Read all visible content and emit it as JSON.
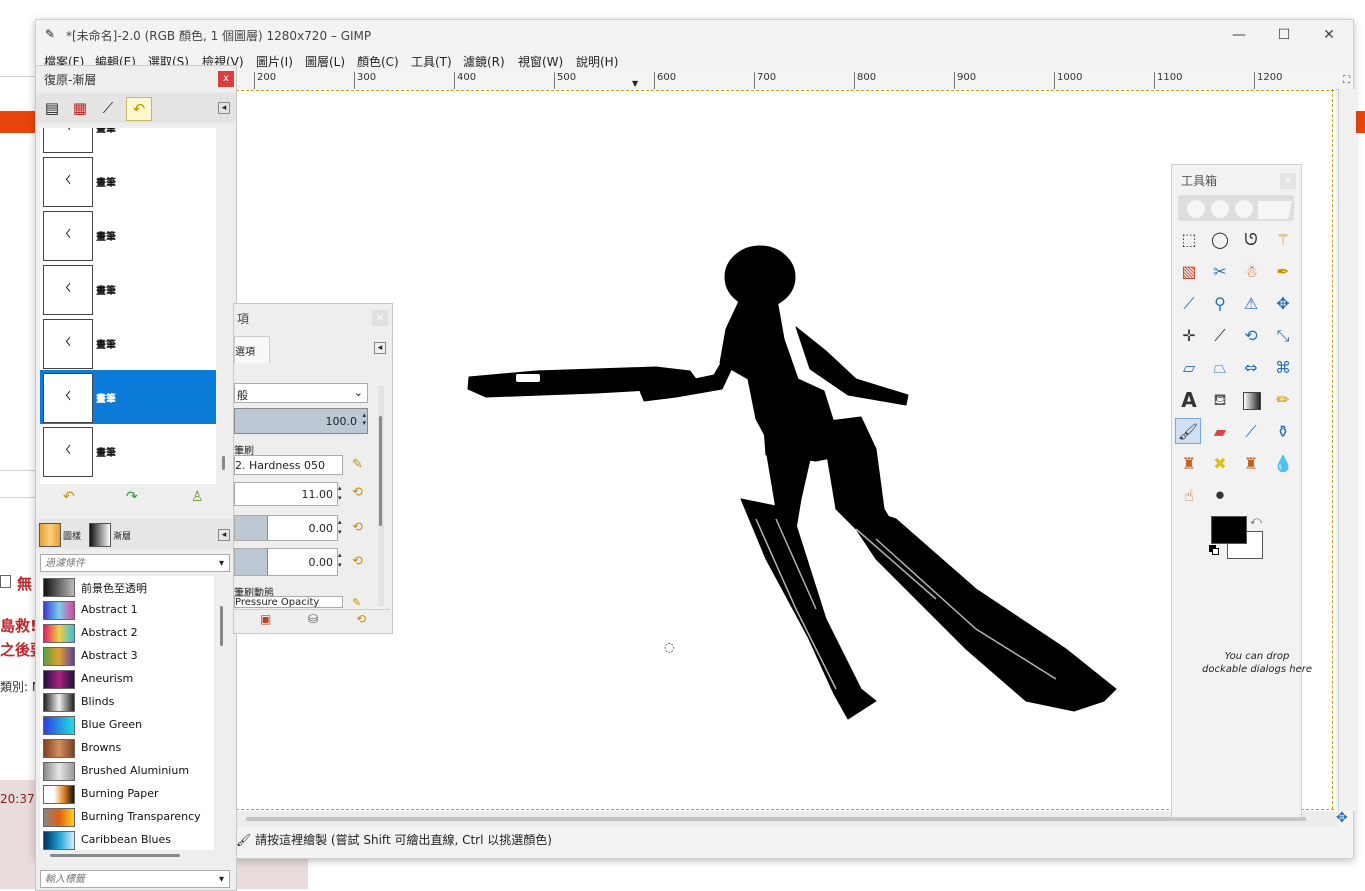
{
  "window": {
    "title": "*[未命名]-2.0 (RGB 顏色, 1 個圖層) 1280x720 – GIMP",
    "controls": [
      "—",
      "☐",
      "✕"
    ]
  },
  "menubar": {
    "items": [
      "檔案(F)",
      "編輯(E)",
      "選取(S)",
      "檢視(V)",
      "圖片(I)",
      "圖層(L)",
      "顏色(C)",
      "工具(T)",
      "濾鏡(R)",
      "視窗(W)",
      "說明(H)"
    ]
  },
  "ruler": {
    "labels": [
      "200",
      "300",
      "400",
      "500",
      "600",
      "700",
      "800",
      "900",
      "1000",
      "1100",
      "1200"
    ]
  },
  "undo_dock": {
    "title": "復原-漸層",
    "close": "x",
    "entries": [
      "畫筆",
      "畫筆",
      "畫筆",
      "畫筆",
      "畫筆",
      "畫筆",
      "畫筆"
    ],
    "selected_index": 5,
    "thumb_glyph": "ᚲ"
  },
  "gradient_dock": {
    "tabs": [
      "圖樣",
      "漸層"
    ],
    "filter_placeholder": "過濾條件",
    "tag_placeholder": "輸入標籤",
    "gradients": [
      {
        "name": "前景色至透明",
        "colors": [
          "#111111",
          "#bbbbbb"
        ]
      },
      {
        "name": "Abstract 1",
        "colors": [
          "#3a3acc",
          "#7ad0f0",
          "#e0409a"
        ]
      },
      {
        "name": "Abstract 2",
        "colors": [
          "#e02060",
          "#f0d040",
          "#30c0e0"
        ]
      },
      {
        "name": "Abstract 3",
        "colors": [
          "#60a040",
          "#e0a030",
          "#6040a0"
        ]
      },
      {
        "name": "Aneurism",
        "colors": [
          "#201040",
          "#b02080",
          "#201040"
        ]
      },
      {
        "name": "Blinds",
        "colors": [
          "#222222",
          "#eeeeee",
          "#222222"
        ]
      },
      {
        "name": "Blue Green",
        "colors": [
          "#3040e0",
          "#20e0e0"
        ]
      },
      {
        "name": "Browns",
        "colors": [
          "#804020",
          "#d09060",
          "#804020"
        ]
      },
      {
        "name": "Brushed Aluminium",
        "colors": [
          "#8a8a8a",
          "#e6e6e6",
          "#9a9a9a"
        ]
      },
      {
        "name": "Burning Paper",
        "colors": [
          "#ffffff",
          "#ffffff",
          "#e08020",
          "#111111"
        ]
      },
      {
        "name": "Burning Transparency",
        "colors": [
          "#888888",
          "#e06010",
          "#ffd020"
        ]
      },
      {
        "name": "Caribbean Blues",
        "colors": [
          "#003060",
          "#20a0d0",
          "#d0f0ff"
        ]
      }
    ]
  },
  "tool_options": {
    "title": "項",
    "tab": "選項",
    "mode": "般",
    "opacity": "100.0",
    "brush_label": "筆刷",
    "brush": "2. Hardness 050",
    "size": "11.00",
    "aspect": "0.00",
    "angle": "0.00",
    "dynamics_label": "筆刷動態",
    "dynamics": "Pressure Opacity"
  },
  "toolbox": {
    "title": "工具箱",
    "drop_hint": "You can drop dockable dialogs here"
  },
  "status": {
    "text": "請按這裡繪製 (嘗試 Shift 可繪出直線, Ctrl 以挑選顏色)"
  },
  "background_page": {
    "red_text": "無",
    "line1": "島救!",
    "line2": "之後要",
    "label": "類別: N",
    "time": "20:37:"
  }
}
